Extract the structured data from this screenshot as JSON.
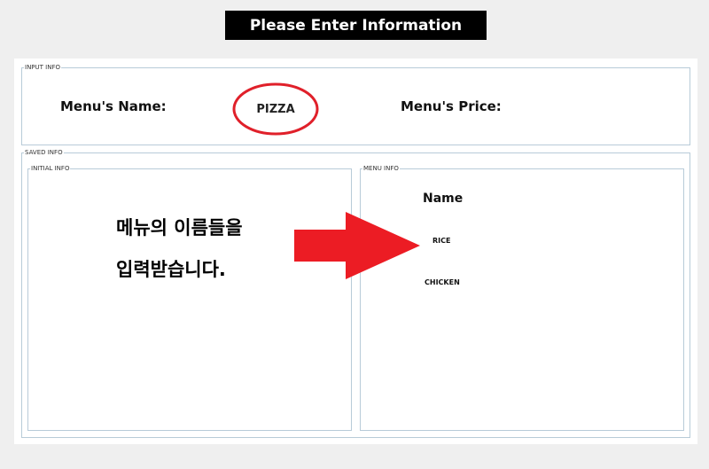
{
  "header": {
    "title": "Please Enter Information"
  },
  "input_info": {
    "legend": "INPUT INFO",
    "menu_name_label": "Menu's Name:",
    "menu_name_value": "PIZZA",
    "menu_price_label": "Menu's Price:"
  },
  "saved_info": {
    "legend": "SAVED INFO",
    "initial_info": {
      "legend": "INITIAL INFO"
    },
    "menu_info": {
      "legend": "MENU INFO",
      "column_header": "Name",
      "items": [
        "RICE",
        "CHICKEN"
      ]
    }
  },
  "annotation": {
    "line1": "메뉴의 이름들을",
    "line2": "입력받습니다.",
    "arrow_color": "#ec1c24",
    "circle_color": "#e0202a"
  }
}
